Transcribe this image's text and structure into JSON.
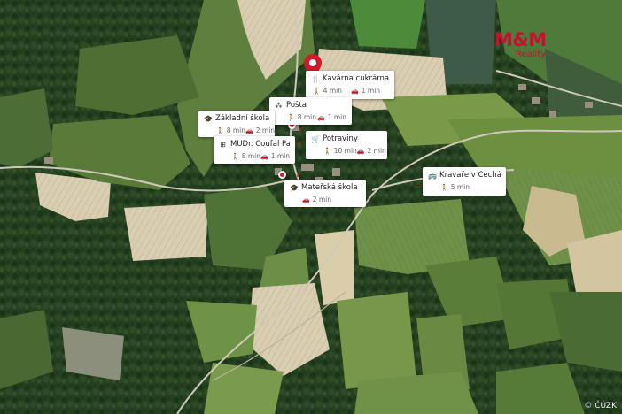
{
  "brand": {
    "name": "M&M",
    "sub": "Reality",
    "color": "#c8102e"
  },
  "copyright": "© ČÚZK",
  "pois": [
    {
      "id": "kavarna",
      "icon": "cutlery-icon",
      "title": "Kavárna cukrárna...",
      "walk": "4 min",
      "car": "1 min"
    },
    {
      "id": "posta",
      "icon": "post-icon",
      "title": "Pošta",
      "walk": "8 min",
      "car": "1 min"
    },
    {
      "id": "zakladni",
      "icon": "school-icon",
      "title": "Základní škola Kr...",
      "walk": "8 min",
      "car": "2 min"
    },
    {
      "id": "mudr",
      "icon": "medical-icon",
      "title": "MUDr. Coufal Pav...",
      "walk": "8 min",
      "car": "1 min"
    },
    {
      "id": "potraviny",
      "icon": "cart-icon",
      "title": "Potraviny",
      "walk": "10 min",
      "car": "2 min"
    },
    {
      "id": "materska",
      "icon": "school-icon",
      "title": "Mateřská škola K...",
      "car": "2 min"
    },
    {
      "id": "kravare",
      "icon": "bus-icon",
      "title": "Kravaře v Čechách",
      "walk": "5 min"
    }
  ]
}
